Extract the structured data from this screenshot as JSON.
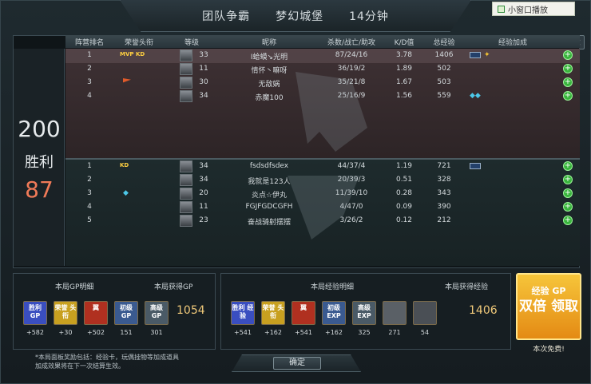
{
  "topbar": {
    "mode": "团队争霸",
    "map": "梦幻城堡",
    "time": "14分钟"
  },
  "mini_window": "小窗口播放",
  "close": "×",
  "headers": {
    "rank": "阵营排名",
    "honor": "荣誉头衔",
    "level": "等级",
    "name": "昵称",
    "kda": "杀数/战亡/助攻",
    "kd": "K/D值",
    "exp": "总经验",
    "bonus": "经验加成"
  },
  "score": {
    "team_a": "200",
    "result": "胜利",
    "team_b": "87"
  },
  "team_a": [
    {
      "rank": "1",
      "level": "33",
      "name": "Ⅰ蛤蟆↘光明",
      "kda": "87/24/16",
      "kd": "3.78",
      "exp": "1406",
      "badge": "MVP KD",
      "bonus_bar": true,
      "bonus_wings": true,
      "highlight": true
    },
    {
      "rank": "2",
      "level": "11",
      "name": "情怀丶嘛呀",
      "kda": "36/19/2",
      "kd": "1.89",
      "exp": "502"
    },
    {
      "rank": "3",
      "level": "30",
      "name": "无敌娲",
      "kda": "35/21/8",
      "kd": "1.67",
      "exp": "503",
      "flag": true
    },
    {
      "rank": "4",
      "level": "34",
      "name": "赤魔100",
      "kda": "25/16/9",
      "kd": "1.56",
      "exp": "559",
      "bonus_gem": true
    }
  ],
  "team_b": [
    {
      "rank": "1",
      "level": "34",
      "name": "fsdsdfsdex",
      "kda": "44/37/4",
      "kd": "1.19",
      "exp": "721",
      "badge": "KD",
      "bonus_bar": true
    },
    {
      "rank": "2",
      "level": "34",
      "name": "我就是123人",
      "kda": "20/39/3",
      "kd": "0.51",
      "exp": "328"
    },
    {
      "rank": "3",
      "level": "20",
      "name": "炎点☆伊丸",
      "kda": "11/39/10",
      "kd": "0.28",
      "exp": "343",
      "gem": true
    },
    {
      "rank": "4",
      "level": "11",
      "name": "FGJFGDCGFH",
      "kda": "4/47/0",
      "kd": "0.09",
      "exp": "390"
    },
    {
      "rank": "5",
      "level": "23",
      "name": "奋战骑射摆摆",
      "kda": "3/26/2",
      "kd": "0.12",
      "exp": "212"
    }
  ],
  "gp_panel": {
    "title": "本局GP明细",
    "total_label": "本局获得GP",
    "total": "1054",
    "items": [
      {
        "label": "胜利 GP",
        "count": "+582"
      },
      {
        "label": "荣誉 头衔",
        "count": "+30"
      },
      {
        "label": "翼",
        "count": "+502"
      },
      {
        "label": "初级 GP",
        "count": "151"
      },
      {
        "label": "高级 GP",
        "count": "301"
      }
    ]
  },
  "exp_panel": {
    "title": "本局经验明细",
    "total_label": "本局获得经验",
    "total": "1406",
    "items": [
      {
        "label": "胜利 经验",
        "count": "+541"
      },
      {
        "label": "荣誉 头衔",
        "count": "+162"
      },
      {
        "label": "翼",
        "count": "+541"
      },
      {
        "label": "初级 EXP",
        "count": "+162"
      },
      {
        "label": "高级 EXP",
        "count": "325"
      },
      {
        "label": "",
        "count": "271"
      },
      {
        "label": "",
        "count": "54"
      }
    ]
  },
  "promo": {
    "line1": "经验 GP",
    "line2": "双倍 领取",
    "note": "本次免费!"
  },
  "note": [
    "*本局面板奖励包括：经验卡，玩偶挂物等加成道具",
    "加成效果将在下一次结算生效。"
  ],
  "ok": "确定"
}
